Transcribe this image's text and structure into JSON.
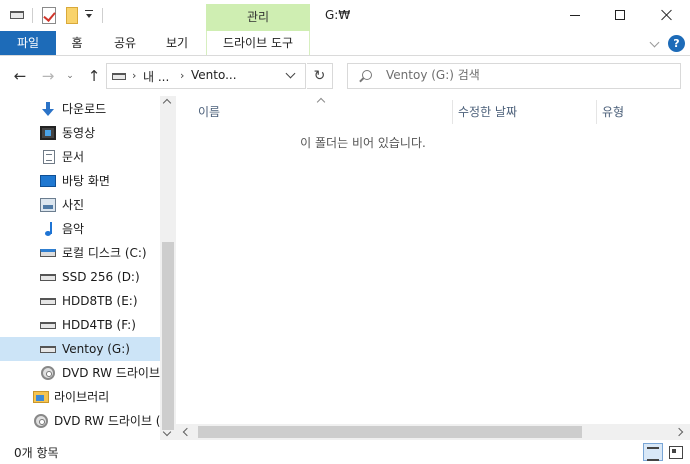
{
  "window": {
    "title": "G:₩",
    "contextual_tab": "관리",
    "controls": [
      "minimize-icon",
      "maximize-icon",
      "close-icon"
    ]
  },
  "ribbon": {
    "file_label": "파일",
    "tabs": [
      "홈",
      "공유",
      "보기"
    ],
    "drive_tools_label": "드라이브 도구",
    "help_label": "?"
  },
  "address": {
    "drive_icon": "drive-icon",
    "ellipsis": "내 ...",
    "current": "Vento...",
    "refresh": "↻",
    "separator": "›"
  },
  "nav": {
    "back": "←",
    "forward": "→",
    "recent": "⌄",
    "up": "↑"
  },
  "search": {
    "placeholder": "Ventoy (G:) 검색"
  },
  "sidebar": {
    "items": [
      {
        "label": "다운로드",
        "icon": "download-icon"
      },
      {
        "label": "동영상",
        "icon": "video-icon"
      },
      {
        "label": "문서",
        "icon": "document-icon"
      },
      {
        "label": "바탕 화면",
        "icon": "desktop-icon"
      },
      {
        "label": "사진",
        "icon": "pictures-icon"
      },
      {
        "label": "음악",
        "icon": "music-icon"
      },
      {
        "label": "로컬 디스크 (C:)",
        "icon": "local-disk-icon"
      },
      {
        "label": "SSD 256 (D:)",
        "icon": "drive-icon"
      },
      {
        "label": "HDD8TB (E:)",
        "icon": "drive-icon"
      },
      {
        "label": "HDD4TB (F:)",
        "icon": "drive-icon"
      },
      {
        "label": "Ventoy (G:)",
        "icon": "drive-icon",
        "selected": true
      },
      {
        "label": "DVD RW 드라이브",
        "icon": "dvd-icon"
      },
      {
        "label": "라이브러리",
        "icon": "library-icon"
      },
      {
        "label": "DVD RW 드라이브 (",
        "icon": "dvd-icon"
      }
    ]
  },
  "content": {
    "columns": [
      "이름",
      "수정한 날짜",
      "유형"
    ],
    "empty_message": "이 폴더는 비어 있습니다."
  },
  "status": {
    "item_count": "0개 항목"
  },
  "colors": {
    "accent": "#1d6bb8",
    "contextual_tab_bg": "#cfeeb2",
    "selection": "#cce4f7",
    "header_text": "#4c607a"
  }
}
